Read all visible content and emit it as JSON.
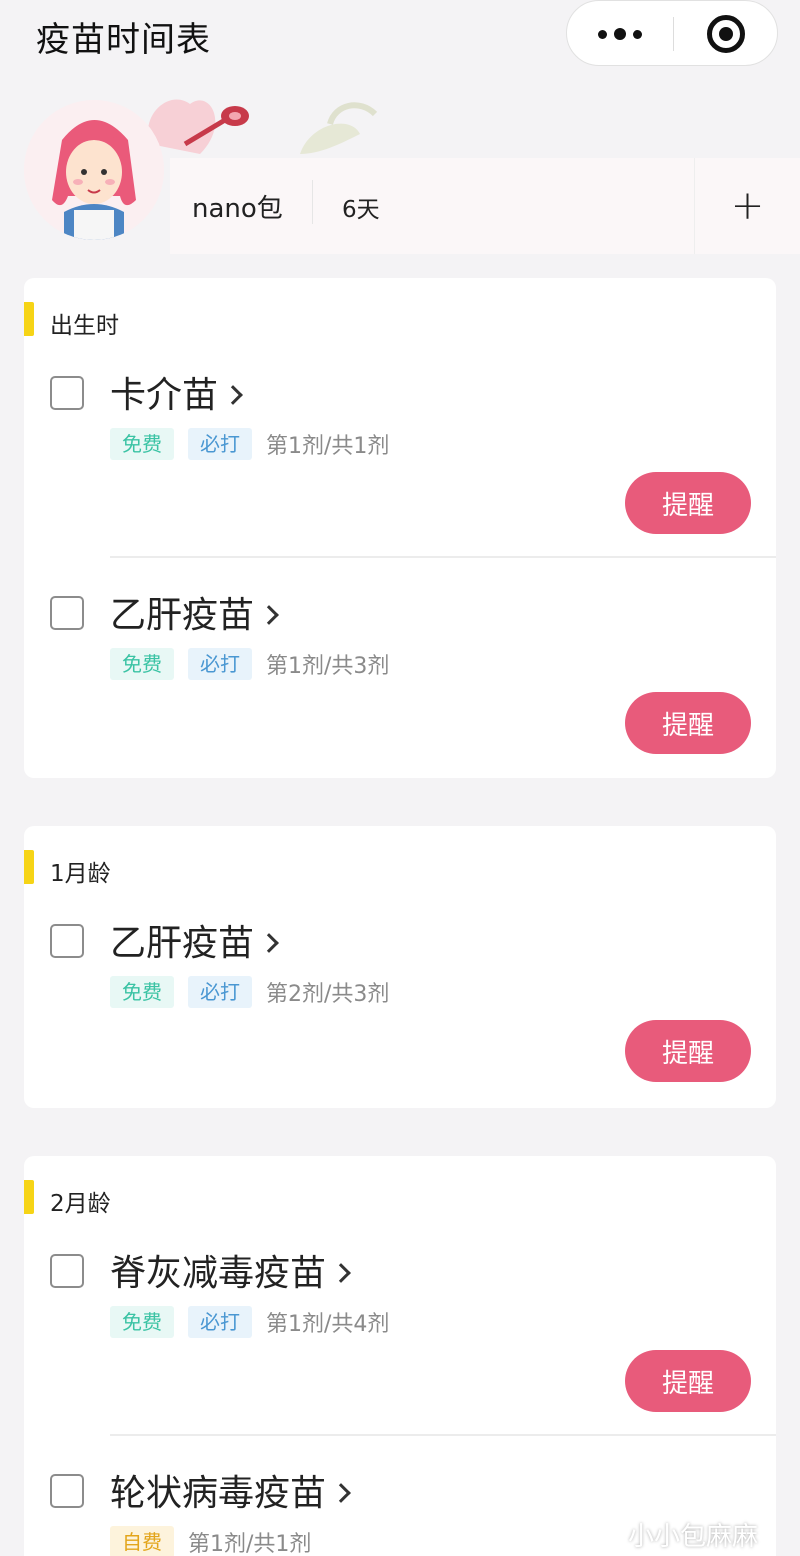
{
  "nav": {
    "title": "疫苗时间表"
  },
  "profile": {
    "name": "nano包",
    "age": "6天",
    "add_label": "+"
  },
  "sections": [
    {
      "title": "出生时",
      "items": [
        {
          "name": "卡介苗",
          "tags": [
            "免费",
            "必打"
          ],
          "dose": "第1剂/共1剂",
          "remind": "提醒"
        },
        {
          "name": "乙肝疫苗",
          "tags": [
            "免费",
            "必打"
          ],
          "dose": "第1剂/共3剂",
          "remind": "提醒"
        }
      ]
    },
    {
      "title": "1月龄",
      "items": [
        {
          "name": "乙肝疫苗",
          "tags": [
            "免费",
            "必打"
          ],
          "dose": "第2剂/共3剂",
          "remind": "提醒"
        }
      ]
    },
    {
      "title": "2月龄",
      "items": [
        {
          "name": "脊灰减毒疫苗",
          "tags": [
            "免费",
            "必打"
          ],
          "dose": "第1剂/共4剂",
          "remind": "提醒"
        },
        {
          "name": "轮状病毒疫苗",
          "tags": [
            "自费"
          ],
          "dose": "第1剂/共1剂"
        }
      ]
    }
  ],
  "watermark": "小小包麻麻",
  "colors": {
    "accent": "#e85b7b",
    "section_mark": "#f6d416",
    "free_tag": "#3bc3a4",
    "must_tag": "#4a97d2",
    "self_tag": "#e3a51b"
  },
  "icons": [
    "more-icon",
    "close-target-icon",
    "add-icon",
    "chevron-right-icon",
    "checkbox-icon",
    "wechat-icon"
  ]
}
